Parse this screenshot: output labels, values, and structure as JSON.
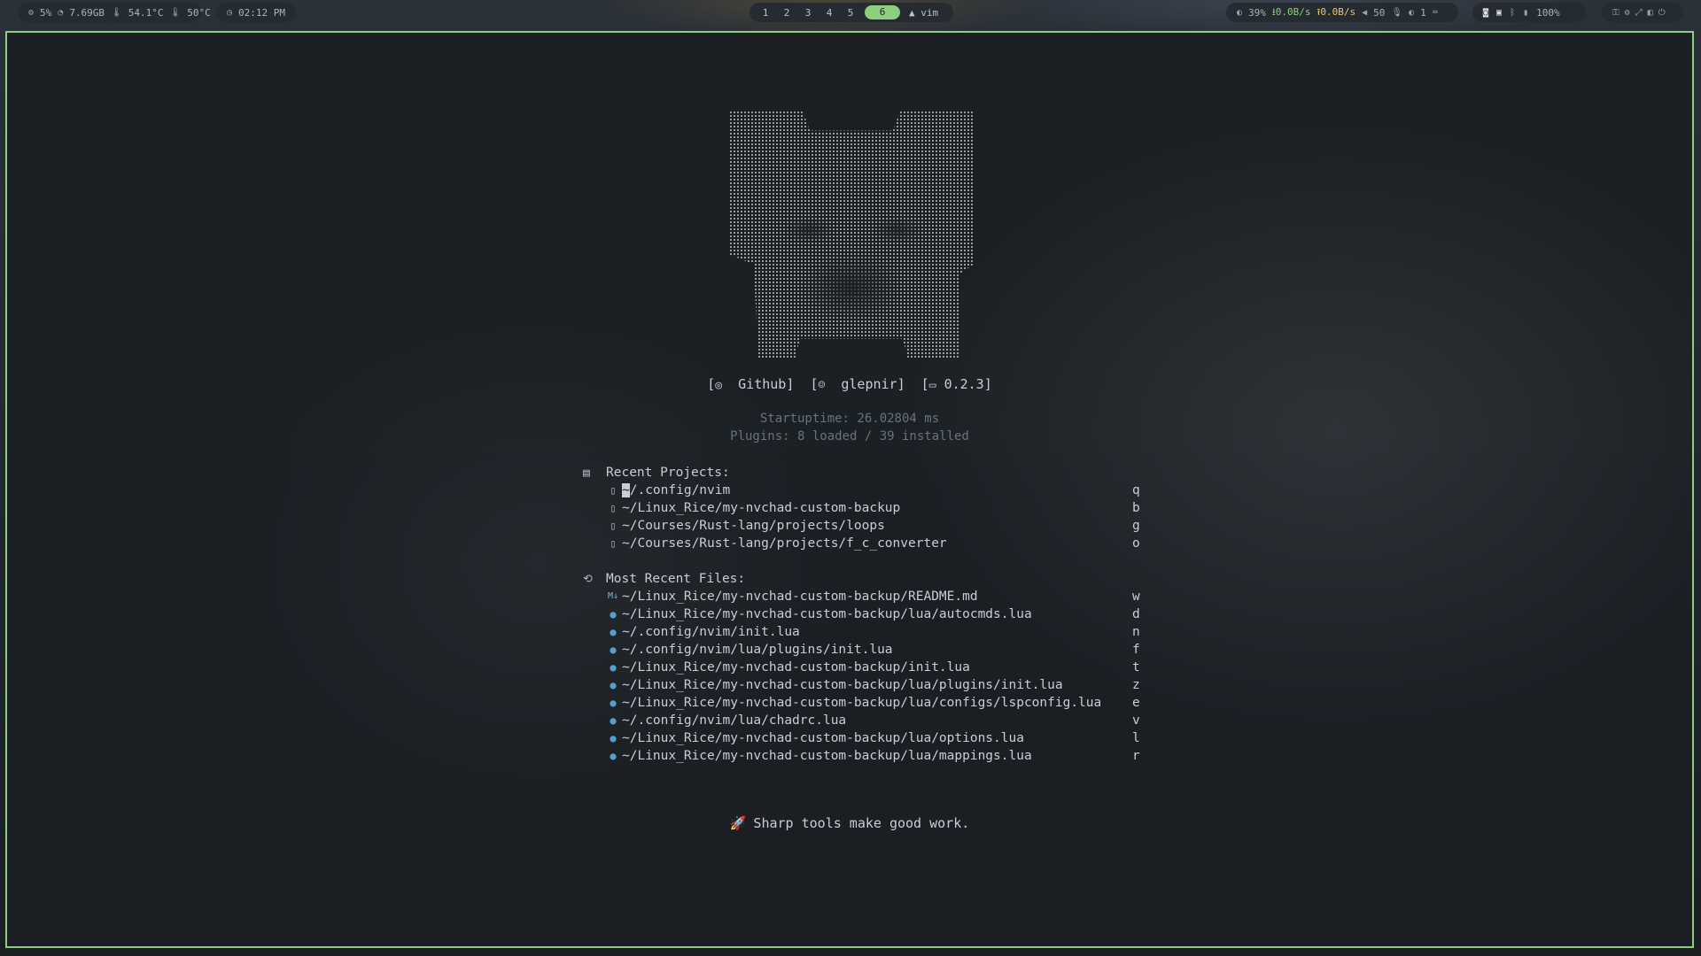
{
  "topbar": {
    "system": {
      "cpu": "5%",
      "mem": "7.69GB",
      "temp_cpu": "54.1°C",
      "temp_gpu": "50°C"
    },
    "clock": "02:12 PM",
    "workspaces": [
      "1",
      "2",
      "3",
      "4",
      "5",
      "6"
    ],
    "active_workspace": "6",
    "active_app": "vim",
    "status": {
      "brightness": "39%",
      "net_down": "0.0B/s",
      "net_up": "0.0B/s",
      "volume": "50",
      "mic": "",
      "notifications": "1",
      "battery": "100%"
    }
  },
  "dashboard": {
    "links": {
      "github": "Github]",
      "user": "glepnir]",
      "version": "0.2.3]"
    },
    "startuptime": "Startuptime: 26.02804 ms",
    "plugins": "Plugins: 8 loaded / 39 installed",
    "recent_projects": {
      "title": "Recent Projects:",
      "items": [
        {
          "path_first": "~",
          "path_rest": "/.config/nvim",
          "key": "q"
        },
        {
          "path_first": "",
          "path_rest": "~/Linux_Rice/my-nvchad-custom-backup",
          "key": "b"
        },
        {
          "path_first": "",
          "path_rest": "~/Courses/Rust-lang/projects/loops",
          "key": "g"
        },
        {
          "path_first": "",
          "path_rest": "~/Courses/Rust-lang/projects/f_c_converter",
          "key": "o"
        }
      ]
    },
    "recent_files": {
      "title": "Most Recent Files:",
      "items": [
        {
          "path": "~/Linux_Rice/my-nvchad-custom-backup/README.md",
          "key": "w",
          "type": "md"
        },
        {
          "path": "~/Linux_Rice/my-nvchad-custom-backup/lua/autocmds.lua",
          "key": "d",
          "type": "lua"
        },
        {
          "path": "~/.config/nvim/init.lua",
          "key": "n",
          "type": "lua"
        },
        {
          "path": "~/.config/nvim/lua/plugins/init.lua",
          "key": "f",
          "type": "lua"
        },
        {
          "path": "~/Linux_Rice/my-nvchad-custom-backup/init.lua",
          "key": "t",
          "type": "lua"
        },
        {
          "path": "~/Linux_Rice/my-nvchad-custom-backup/lua/plugins/init.lua",
          "key": "z",
          "type": "lua"
        },
        {
          "path": "~/Linux_Rice/my-nvchad-custom-backup/lua/configs/lspconfig.lua",
          "key": "e",
          "type": "lua"
        },
        {
          "path": "~/.config/nvim/lua/chadrc.lua",
          "key": "v",
          "type": "lua"
        },
        {
          "path": "~/Linux_Rice/my-nvchad-custom-backup/lua/options.lua",
          "key": "l",
          "type": "lua"
        },
        {
          "path": "~/Linux_Rice/my-nvchad-custom-backup/lua/mappings.lua",
          "key": "r",
          "type": "lua"
        }
      ]
    },
    "footer": "Sharp tools make good work."
  },
  "colors": {
    "accent": "#8ccf7e",
    "background": "#1b1f24",
    "foreground": "#c8ced6",
    "lua": "#51a0cf",
    "net_up": "#e5c76b"
  }
}
